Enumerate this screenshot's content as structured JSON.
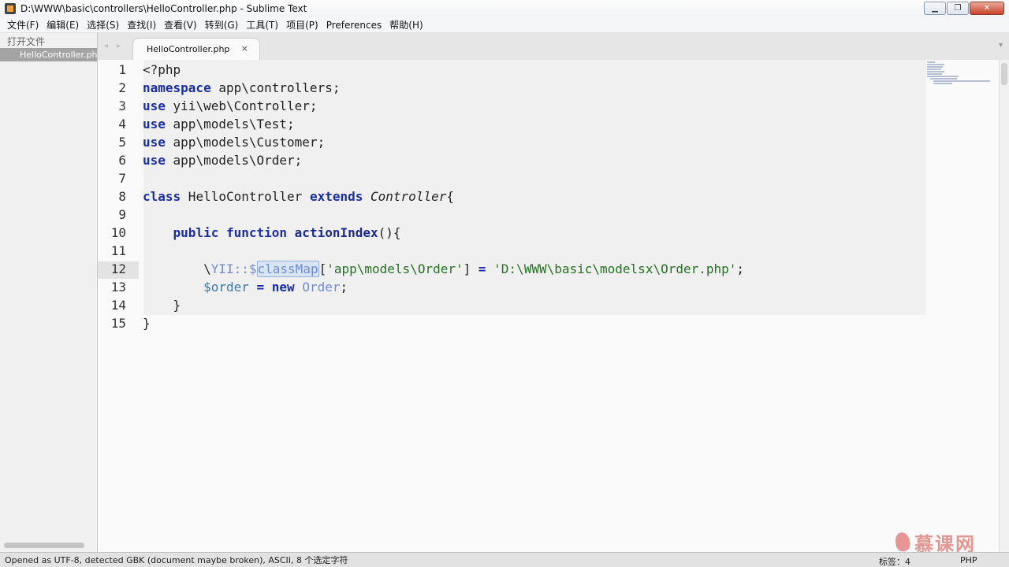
{
  "window": {
    "title": "D:\\WWW\\basic\\controllers\\HelloController.php - Sublime Text",
    "minimize": "▁",
    "maximize": "❐",
    "close": "✕"
  },
  "menu": [
    "文件(F)",
    "编辑(E)",
    "选择(S)",
    "查找(I)",
    "查看(V)",
    "转到(G)",
    "工具(T)",
    "项目(P)",
    "Preferences",
    "帮助(H)"
  ],
  "sidebar": {
    "header": "打开文件",
    "files": [
      "HelloController.php"
    ]
  },
  "tabs": {
    "nav_prev": "◂",
    "nav_next": "▸",
    "active_label": "HelloController.php",
    "close": "×",
    "dropdown": "▾"
  },
  "editor": {
    "line_numbers": [
      "1",
      "2",
      "3",
      "4",
      "5",
      "6",
      "7",
      "8",
      "9",
      "10",
      "11",
      "12",
      "13",
      "14",
      "15"
    ],
    "current_line": "12",
    "code": {
      "l1": "<?php",
      "l2_kw": "namespace",
      "l2_rest": " app\\controllers;",
      "l3_kw": "use",
      "l3_rest": " yii\\web\\Controller;",
      "l4_kw": "use",
      "l4_rest": " app\\models\\Test;",
      "l5_kw": "use",
      "l5_rest": " app\\models\\Customer;",
      "l6_kw": "use",
      "l6_rest": " app\\models\\Order;",
      "l8_kw1": "class",
      "l8_name": " HelloController ",
      "l8_kw2": "extends",
      "l8_space": " ",
      "l8_parent": "Controller",
      "l8_brace": "{",
      "l10_indent": "    ",
      "l10_kw1": "public",
      "l10_space": " ",
      "l10_kw2": "function",
      "l10_space2": " ",
      "l10_fn": "actionIndex",
      "l10_rest": "(){",
      "l12_indent": "        ",
      "l12_bs": "\\",
      "l12_cls": "YII",
      "l12_op": "::",
      "l12_dollar": "$",
      "l12_prop": "classMap",
      "l12_br1": "[",
      "l12_key": "'app\\models\\Order'",
      "l12_br2": "] ",
      "l12_eq": "=",
      "l12_sp": " ",
      "l12_val": "'D:\\WWW\\basic\\modelsx\\Order.php'",
      "l12_end": ";",
      "l13_indent": "        ",
      "l13_var": "$order",
      "l13_sp1": " ",
      "l13_eq": "=",
      "l13_sp2": " ",
      "l13_kw": "new",
      "l13_sp3": " ",
      "l13_cls": "Order",
      "l13_end": ";",
      "l14": "    }",
      "l15": "}"
    }
  },
  "status": {
    "message": "Opened as UTF-8, detected GBK (document maybe broken), ASCII, 8  个选定字符",
    "tab_size": "标签：4",
    "syntax": "PHP"
  },
  "watermark": {
    "text": "慕课网"
  },
  "colors": {
    "keyword": "#1b2ea8",
    "string": "#227322",
    "variable": "#3c79a8",
    "constant": "#6f8bd3"
  }
}
